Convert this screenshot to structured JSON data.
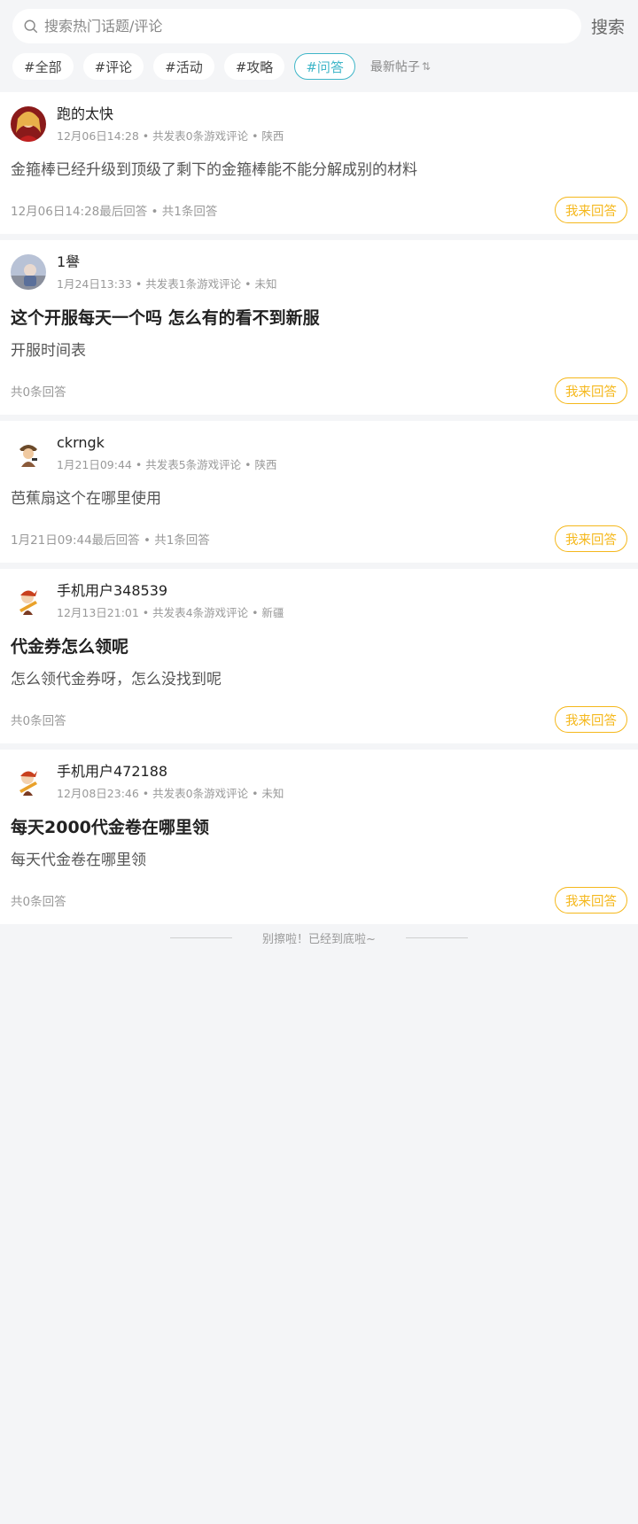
{
  "search": {
    "placeholder": "搜索热门话题/评论",
    "button_label": "搜索"
  },
  "filters": {
    "chips": [
      "#全部",
      "#评论",
      "#活动",
      "#攻略",
      "#问答"
    ],
    "active": "#问答",
    "sort_label": "最新帖子",
    "sort_icon": "⇅"
  },
  "posts": [
    {
      "username": "跑的太快",
      "subline": "12月06日14:28 • 共发表0条游戏评论 • 陕西",
      "title": "",
      "body": "金箍棒已经升级到顶级了剩下的金箍棒能不能分解成别的材料",
      "footer": "12月06日14:28最后回答 • 共1条回答",
      "answer_label": "我来回答"
    },
    {
      "username": "1譽",
      "subline": "1月24日13:33 • 共发表1条游戏评论 • 未知",
      "title": "这个开服每天一个吗 怎么有的看不到新服",
      "body": "开服时间表",
      "footer": "共0条回答",
      "answer_label": "我来回答"
    },
    {
      "username": "ckrngk",
      "subline": "1月21日09:44 • 共发表5条游戏评论 • 陕西",
      "title": "",
      "body": "芭蕉扇这个在哪里使用",
      "footer": "1月21日09:44最后回答 • 共1条回答",
      "answer_label": "我来回答"
    },
    {
      "username": "手机用户348539",
      "subline": "12月13日21:01 • 共发表4条游戏评论 • 新疆",
      "title": "代金券怎么领呢",
      "body": "怎么领代金券呀，怎么没找到呢",
      "footer": "共0条回答",
      "answer_label": "我来回答"
    },
    {
      "username": "手机用户472188",
      "subline": "12月08日23:46 • 共发表0条游戏评论 • 未知",
      "title": "每天2000代金卷在哪里领",
      "body": "每天代金卷在哪里领",
      "footer": "共0条回答",
      "answer_label": "我来回答"
    }
  ],
  "end_tip": "别擦啦！已经到底啦~",
  "colors": {
    "accent": "#3fb6c8",
    "answer": "#f5b81c",
    "background": "#f4f5f7"
  }
}
